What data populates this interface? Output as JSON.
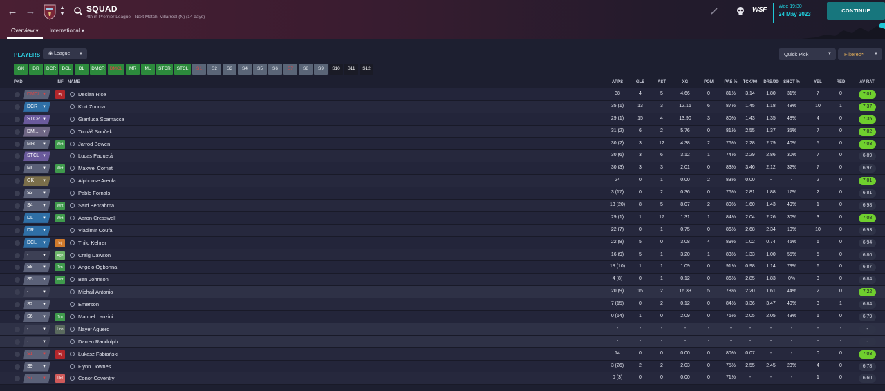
{
  "header": {
    "title": "SQUAD",
    "subtitle": "4th in Premier League - Next Match: Villarreal (N) (14 days)",
    "tabs": [
      "Overview",
      "International"
    ],
    "date_day": "Wed 19:30",
    "date_full": "24 May 2023",
    "continue_label": "CONTINUE",
    "logo_text": "WSF",
    "accent": "#1fc7d6"
  },
  "controls": {
    "players_label": "PLAYERS",
    "view_label": "League",
    "quick_pick_label": "Quick Pick",
    "filtered_label": "Filtered*"
  },
  "position_buttons": [
    {
      "label": "GK",
      "style": "green"
    },
    {
      "label": "DR",
      "style": "green"
    },
    {
      "label": "DCR",
      "style": "green"
    },
    {
      "label": "DCL",
      "style": "green"
    },
    {
      "label": "DL",
      "style": "green"
    },
    {
      "label": "DMCR",
      "style": "green"
    },
    {
      "label": "DMCL",
      "style": "green"
    },
    {
      "label": "MR",
      "style": "green"
    },
    {
      "label": "ML",
      "style": "green"
    },
    {
      "label": "STCR",
      "style": "green"
    },
    {
      "label": "STCL",
      "style": "green"
    },
    {
      "label": "S1",
      "style": "grey"
    },
    {
      "label": "S2",
      "style": "grey"
    },
    {
      "label": "S3",
      "style": "grey"
    },
    {
      "label": "S4",
      "style": "grey"
    },
    {
      "label": "S5",
      "style": "grey"
    },
    {
      "label": "S6",
      "style": "grey"
    },
    {
      "label": "S7",
      "style": "grey"
    },
    {
      "label": "S8",
      "style": "grey"
    },
    {
      "label": "S9",
      "style": "grey"
    },
    {
      "label": "S10",
      "style": "dark"
    },
    {
      "label": "S11",
      "style": "dark"
    },
    {
      "label": "S12",
      "style": "dark"
    }
  ],
  "table": {
    "columns": [
      "PKD",
      "INF",
      "NAME",
      "APPS",
      "GLS",
      "AST",
      "XG",
      "POM",
      "PAS %",
      "TCK/90",
      "DRB/90",
      "SHOT %",
      "YEL",
      "RED",
      "AV RAT"
    ],
    "rows": [
      {
        "pos": "DMCL",
        "pos_style": "redt",
        "inf": "Inj",
        "inf_style": "red",
        "name": "Declan Rice",
        "apps": "38",
        "gls": "4",
        "ast": "5",
        "xg": "4.66",
        "pom": "0",
        "pas": "81%",
        "tck": "3.14",
        "drb": "1.80",
        "shot": "31%",
        "yel": "7",
        "red": "0",
        "rat": "7.01",
        "rat_hi": true
      },
      {
        "pos": "DCR",
        "pos_style": "blue",
        "inf": "",
        "inf_style": "",
        "name": "Kurt Zouma",
        "apps": "35 (1)",
        "gls": "13",
        "ast": "3",
        "xg": "12.16",
        "pom": "6",
        "pas": "87%",
        "tck": "1.45",
        "drb": "1.18",
        "shot": "48%",
        "yel": "10",
        "red": "1",
        "rat": "7.37",
        "rat_hi": true
      },
      {
        "pos": "STCR",
        "pos_style": "purple",
        "inf": "",
        "inf_style": "",
        "name": "Gianluca Scamacca",
        "apps": "29 (1)",
        "gls": "15",
        "ast": "4",
        "xg": "13.90",
        "pom": "3",
        "pas": "80%",
        "tck": "1.43",
        "drb": "1.35",
        "shot": "48%",
        "yel": "4",
        "red": "0",
        "rat": "7.35",
        "rat_hi": true
      },
      {
        "pos": "DM...",
        "pos_style": "mauve",
        "inf": "",
        "inf_style": "",
        "name": "Tomáš Souček",
        "apps": "31 (2)",
        "gls": "6",
        "ast": "2",
        "xg": "5.76",
        "pom": "0",
        "pas": "81%",
        "tck": "2.55",
        "drb": "1.37",
        "shot": "35%",
        "yel": "7",
        "red": "0",
        "rat": "7.02",
        "rat_hi": true
      },
      {
        "pos": "MR",
        "pos_style": "slate",
        "inf": "Wnt",
        "inf_style": "green",
        "name": "Jarrod Bowen",
        "apps": "30 (2)",
        "gls": "3",
        "ast": "12",
        "xg": "4.38",
        "pom": "2",
        "pas": "76%",
        "tck": "2.28",
        "drb": "2.79",
        "shot": "40%",
        "yel": "5",
        "red": "0",
        "rat": "7.03",
        "rat_hi": true
      },
      {
        "pos": "STCL",
        "pos_style": "purple",
        "inf": "",
        "inf_style": "",
        "name": "Lucas Paquetá",
        "apps": "30 (6)",
        "gls": "3",
        "ast": "6",
        "xg": "3.12",
        "pom": "1",
        "pas": "74%",
        "tck": "2.29",
        "drb": "2.86",
        "shot": "30%",
        "yel": "7",
        "red": "0",
        "rat": "6.89",
        "rat_hi": false
      },
      {
        "pos": "ML",
        "pos_style": "slate",
        "inf": "Wnt",
        "inf_style": "green",
        "name": "Maxwel Cornet",
        "apps": "30 (3)",
        "gls": "3",
        "ast": "3",
        "xg": "2.01",
        "pom": "0",
        "pas": "83%",
        "tck": "3.46",
        "drb": "2.12",
        "shot": "32%",
        "yel": "7",
        "red": "0",
        "rat": "6.97",
        "rat_hi": false
      },
      {
        "pos": "GK",
        "pos_style": "olive",
        "inf": "",
        "inf_style": "",
        "name": "Alphonse Areola",
        "apps": "24",
        "gls": "0",
        "ast": "1",
        "xg": "0.00",
        "pom": "2",
        "pas": "83%",
        "tck": "0.00",
        "drb": "-",
        "shot": "-",
        "yel": "2",
        "red": "0",
        "rat": "7.01",
        "rat_hi": true
      },
      {
        "pos": "S3",
        "pos_style": "slate",
        "inf": "",
        "inf_style": "",
        "name": "Pablo Fornals",
        "apps": "3 (17)",
        "gls": "0",
        "ast": "2",
        "xg": "0.36",
        "pom": "0",
        "pas": "76%",
        "tck": "2.81",
        "drb": "1.88",
        "shot": "17%",
        "yel": "2",
        "red": "0",
        "rat": "6.81",
        "rat_hi": false
      },
      {
        "pos": "S4",
        "pos_style": "slate",
        "inf": "Wnt",
        "inf_style": "green",
        "name": "Saïd Benrahma",
        "apps": "13 (20)",
        "gls": "8",
        "ast": "5",
        "xg": "8.07",
        "pom": "2",
        "pas": "80%",
        "tck": "1.60",
        "drb": "1.43",
        "shot": "49%",
        "yel": "1",
        "red": "0",
        "rat": "6.98",
        "rat_hi": false
      },
      {
        "pos": "DL",
        "pos_style": "blue",
        "inf": "Wnt",
        "inf_style": "green",
        "name": "Aaron Cresswell",
        "apps": "29 (1)",
        "gls": "1",
        "ast": "17",
        "xg": "1.31",
        "pom": "1",
        "pas": "84%",
        "tck": "2.04",
        "drb": "2.26",
        "shot": "30%",
        "yel": "3",
        "red": "0",
        "rat": "7.08",
        "rat_hi": true
      },
      {
        "pos": "DR",
        "pos_style": "blue",
        "inf": "",
        "inf_style": "",
        "name": "Vladimír Coufal",
        "apps": "22 (7)",
        "gls": "0",
        "ast": "1",
        "xg": "0.75",
        "pom": "0",
        "pas": "86%",
        "tck": "2.68",
        "drb": "2.34",
        "shot": "10%",
        "yel": "10",
        "red": "0",
        "rat": "6.93",
        "rat_hi": false
      },
      {
        "pos": "DCL",
        "pos_style": "blue",
        "inf": "Inj",
        "inf_style": "orange",
        "name": "Thilo Kehrer",
        "apps": "22 (8)",
        "gls": "5",
        "ast": "0",
        "xg": "3.08",
        "pom": "4",
        "pas": "89%",
        "tck": "1.02",
        "drb": "0.74",
        "shot": "45%",
        "yel": "6",
        "red": "0",
        "rat": "6.94",
        "rat_hi": false
      },
      {
        "pos": "-",
        "pos_style": "dash",
        "inf": "Agn",
        "inf_style": "lgreen",
        "name": "Craig Dawson",
        "apps": "16 (9)",
        "gls": "5",
        "ast": "1",
        "xg": "3.20",
        "pom": "1",
        "pas": "83%",
        "tck": "1.33",
        "drb": "1.00",
        "shot": "55%",
        "yel": "5",
        "red": "0",
        "rat": "6.80",
        "rat_hi": false
      },
      {
        "pos": "S8",
        "pos_style": "slate",
        "inf": "Trn",
        "inf_style": "green",
        "name": "Angelo Ogbonna",
        "apps": "18 (10)",
        "gls": "1",
        "ast": "1",
        "xg": "1.09",
        "pom": "0",
        "pas": "91%",
        "tck": "0.98",
        "drb": "1.14",
        "shot": "79%",
        "yel": "6",
        "red": "0",
        "rat": "6.87",
        "rat_hi": false
      },
      {
        "pos": "S5",
        "pos_style": "slate",
        "inf": "Wnt",
        "inf_style": "green",
        "name": "Ben Johnson",
        "apps": "4 (8)",
        "gls": "0",
        "ast": "1",
        "xg": "0.12",
        "pom": "0",
        "pas": "86%",
        "tck": "2.85",
        "drb": "1.83",
        "shot": "0%",
        "yel": "3",
        "red": "0",
        "rat": "6.84",
        "rat_hi": false
      },
      {
        "pos": "-",
        "pos_style": "dash",
        "inf": "",
        "inf_style": "",
        "name": "Michail Antonio",
        "apps": "20 (9)",
        "gls": "15",
        "ast": "2",
        "xg": "16.33",
        "pom": "5",
        "pas": "78%",
        "tck": "2.20",
        "drb": "1.61",
        "shot": "44%",
        "yel": "2",
        "red": "0",
        "rat": "7.22",
        "rat_hi": true
      },
      {
        "pos": "S2",
        "pos_style": "slate",
        "inf": "",
        "inf_style": "",
        "name": "Emerson",
        "apps": "7 (15)",
        "gls": "0",
        "ast": "2",
        "xg": "0.12",
        "pom": "0",
        "pas": "84%",
        "tck": "3.36",
        "drb": "3.47",
        "shot": "40%",
        "yel": "3",
        "red": "1",
        "rat": "6.84",
        "rat_hi": false
      },
      {
        "pos": "S6",
        "pos_style": "slate",
        "inf": "Trn",
        "inf_style": "green",
        "name": "Manuel Lanzini",
        "apps": "0 (14)",
        "gls": "1",
        "ast": "0",
        "xg": "2.09",
        "pom": "0",
        "pas": "76%",
        "tck": "2.05",
        "drb": "2.05",
        "shot": "43%",
        "yel": "1",
        "red": "0",
        "rat": "6.79",
        "rat_hi": false
      },
      {
        "pos": "-",
        "pos_style": "dash",
        "inf": "Unh",
        "inf_style": "grey",
        "name": "Nayef Aguerd",
        "apps": "-",
        "gls": "-",
        "ast": "-",
        "xg": "-",
        "pom": "-",
        "pas": "-",
        "tck": "-",
        "drb": "-",
        "shot": "-",
        "yel": "-",
        "red": "-",
        "rat": "-",
        "rat_hi": false
      },
      {
        "pos": "-",
        "pos_style": "dash",
        "inf": "",
        "inf_style": "",
        "name": "Darren Randolph",
        "apps": "-",
        "gls": "-",
        "ast": "-",
        "xg": "-",
        "pom": "-",
        "pas": "-",
        "tck": "-",
        "drb": "-",
        "shot": "-",
        "yel": "-",
        "red": "-",
        "rat": "-",
        "rat_hi": false
      },
      {
        "pos": "S1",
        "pos_style": "redt",
        "inf": "Inj",
        "inf_style": "red",
        "name": "Łukasz Fabiański",
        "apps": "14",
        "gls": "0",
        "ast": "0",
        "xg": "0.00",
        "pom": "0",
        "pas": "80%",
        "tck": "0.07",
        "drb": "-",
        "shot": "-",
        "yel": "0",
        "red": "0",
        "rat": "7.03",
        "rat_hi": true
      },
      {
        "pos": "S9",
        "pos_style": "slate",
        "inf": "",
        "inf_style": "",
        "name": "Flynn Downes",
        "apps": "3 (26)",
        "gls": "2",
        "ast": "2",
        "xg": "2.03",
        "pom": "0",
        "pas": "75%",
        "tck": "2.55",
        "drb": "2.45",
        "shot": "23%",
        "yel": "4",
        "red": "0",
        "rat": "6.78",
        "rat_hi": false
      },
      {
        "pos": "S7",
        "pos_style": "redt",
        "inf": "Unl",
        "inf_style": "salmon",
        "name": "Conor Coventry",
        "apps": "0 (3)",
        "gls": "0",
        "ast": "0",
        "xg": "0.00",
        "pom": "0",
        "pas": "71%",
        "tck": "-",
        "drb": "-",
        "shot": "-",
        "yel": "1",
        "red": "0",
        "rat": "6.60",
        "rat_hi": false
      }
    ]
  }
}
